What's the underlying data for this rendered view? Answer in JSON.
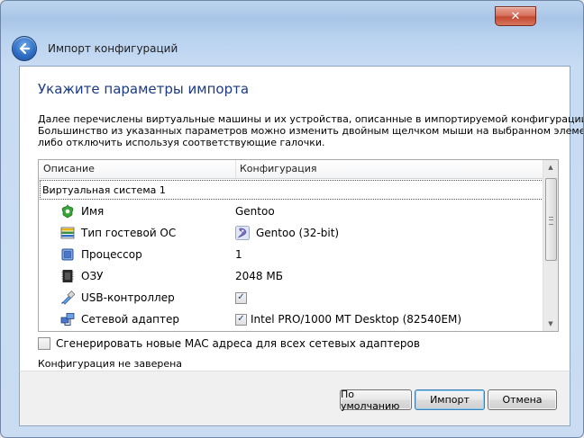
{
  "window": {
    "title": "Импорт конфигураций",
    "close_glyph": "✕"
  },
  "page": {
    "heading": "Укажите параметры импорта",
    "description_lines": [
      "Далее перечислены виртуальные машины и их устройства, описанные в импортируемой конфигурации.",
      "Большинство из указанных параметров можно изменить двойным щелчком мыши на выбранном элементе,",
      "либо отключить используя соответствующие галочки."
    ]
  },
  "table": {
    "columns": [
      "Описание",
      "Конфигурация"
    ],
    "group_label": "Виртуальная система 1",
    "rows": [
      {
        "icon": "name-icon",
        "label": "Имя",
        "value": "Gentoo"
      },
      {
        "icon": "os-type-icon",
        "label": "Тип гостевой ОС",
        "value": "Gentoo (32-bit)",
        "value_icon": "gentoo-logo-icon"
      },
      {
        "icon": "cpu-icon",
        "label": "Процессор",
        "value": "1"
      },
      {
        "icon": "ram-icon",
        "label": "ОЗУ",
        "value": "2048 МБ"
      },
      {
        "icon": "usb-icon",
        "label": "USB-контроллер",
        "value": "",
        "checked": true
      },
      {
        "icon": "network-adapter-icon",
        "label": "Сетевой адаптер",
        "value": "Intel PRO/1000 MT Desktop (82540EM)",
        "checked": true
      }
    ],
    "scroll": {
      "up": "▲",
      "down": "▼"
    }
  },
  "options": {
    "mac_label": "Сгенерировать новые MAC адреса для всех сетевых адаптеров",
    "mac_checked": false
  },
  "status_text": "Конфигурация не заверена",
  "buttons": {
    "defaults": "По умолчанию",
    "import": "Импорт",
    "cancel": "Отмена"
  },
  "check_glyph": "✓",
  "colors": {
    "heading": "#1c3a84",
    "close": "#c44a31",
    "back": "#2f6fc6"
  }
}
